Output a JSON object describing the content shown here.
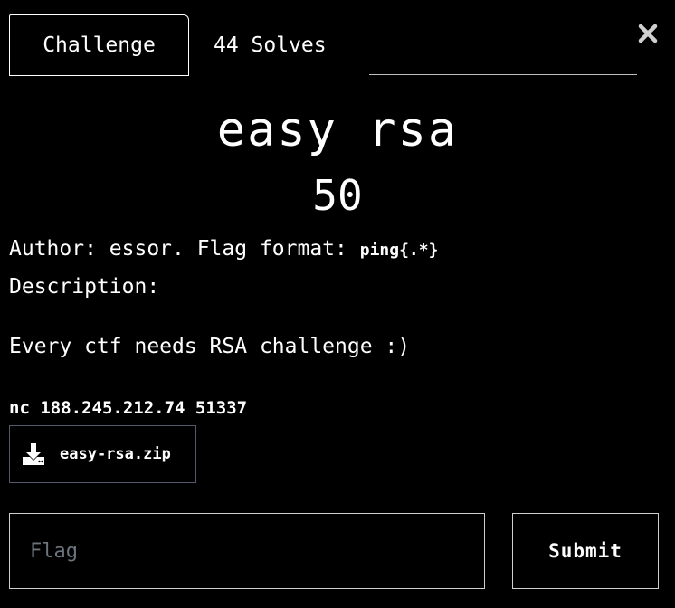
{
  "tabs": {
    "challenge_label": "Challenge",
    "solves_label": "44 Solves"
  },
  "close": {
    "icon": "close-icon"
  },
  "challenge": {
    "name": "easy rsa",
    "points": "50",
    "author_text": "Author: essor. Flag format: ",
    "flag_format": "ping{.*}",
    "description_label": "Description:",
    "description_text": "Every ctf needs RSA challenge :)",
    "connection": "nc 188.245.212.74 51337"
  },
  "download": {
    "icon": "download-icon",
    "label": "easy-rsa.zip"
  },
  "flag_input": {
    "placeholder": "Flag",
    "value": ""
  },
  "submit": {
    "label": "Submit"
  },
  "colors": {
    "background": "#000000",
    "text": "#ffffff",
    "border": "#cfcfcf",
    "download_border": "#555a6a",
    "placeholder": "#6c757d"
  }
}
